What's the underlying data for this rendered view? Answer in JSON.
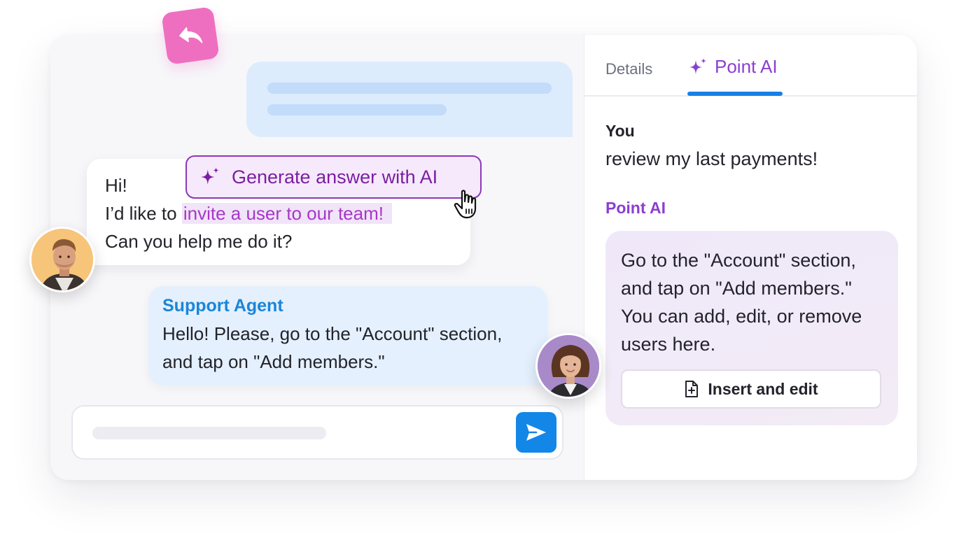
{
  "chat": {
    "customer": {
      "line1": "Hi!",
      "line2_prefix": "I I’d like to",
      "line2_prefix_clean": "I’d like to",
      "line2_highlight": "invite a user to our team!",
      "line3": "Can you help me do it?"
    },
    "ai_chip_label": "Generate answer with AI",
    "agent": {
      "name": "Support Agent",
      "message": "Hello! Please, go to the \"Account\" section, and tap on \"Add members.\""
    }
  },
  "side_panel": {
    "tabs": {
      "details": "Details",
      "point_ai": "Point AI"
    },
    "you_label": "You",
    "you_text": "review my last payments!",
    "ai_label": "Point AI",
    "ai_answer": "Go to the \"Account\" section, and tap on \"Add members.\" You can add, edit, or remove users here.",
    "insert_button": "Insert and edit"
  },
  "icons": {
    "reply": "reply-icon",
    "sparkle": "sparkle-icon",
    "cursor": "hand-pointer-icon",
    "send": "send-icon",
    "document_add": "document-add-icon"
  },
  "colors": {
    "accent_blue": "#1287e8",
    "ai_purple": "#8b3fd1",
    "reply_pink": "#ee6fc0",
    "agent_bubble": "#e4f0fd"
  }
}
